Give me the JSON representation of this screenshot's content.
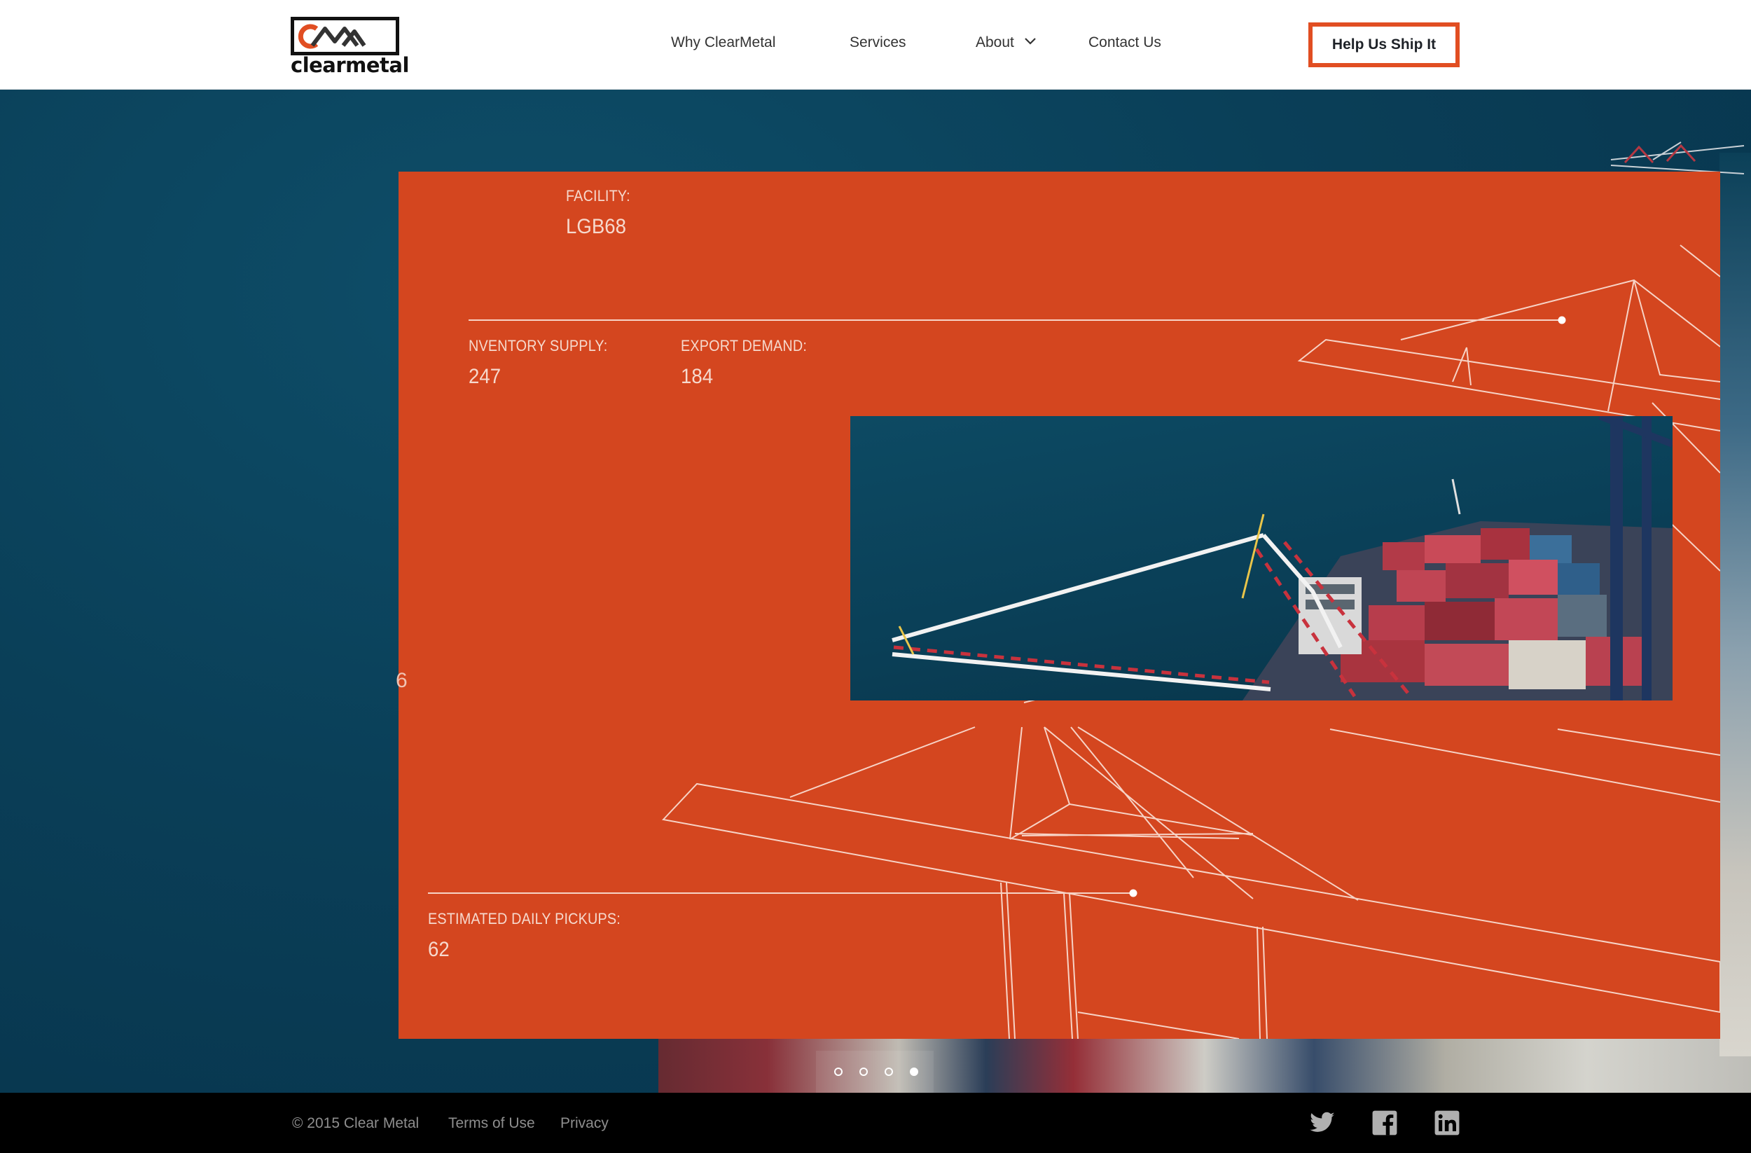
{
  "brand": {
    "logo_text": "clearmetal",
    "logo_mark": "CM",
    "accent_color": "#e14e22"
  },
  "nav": {
    "items": [
      "Why ClearMetal",
      "Services",
      "About",
      "Contact Us"
    ],
    "cta_label": "Help Us Ship It"
  },
  "stats": {
    "facility_label": "FACILITY:",
    "facility_value": "LGB68",
    "inventory_label": "NVENTORY SUPPLY:",
    "inventory_value": "247",
    "export_label": "EXPORT DEMAND:",
    "export_value": "184",
    "pickups_label": "ESTIMATED DAILY PICKUPS:",
    "pickups_value": "62",
    "side_digit": "6"
  },
  "slider": {
    "total": 4,
    "active_index": 3
  },
  "footer": {
    "copyright": "© 2015 Clear Metal",
    "terms": "Terms of Use",
    "privacy": "Privacy",
    "social": [
      "twitter-icon",
      "facebook-icon",
      "linkedin-icon"
    ]
  },
  "colors": {
    "panel": "#d4461f",
    "ocean": "#0a3f58",
    "footer": "#000000"
  }
}
